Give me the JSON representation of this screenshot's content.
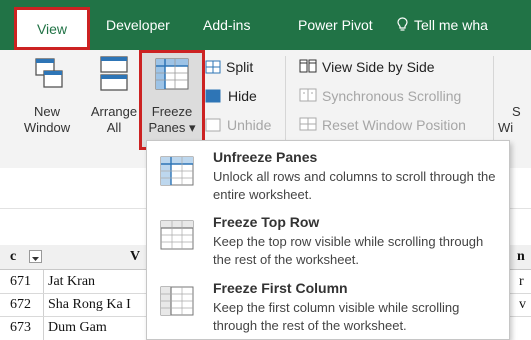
{
  "tabs": {
    "view": "View",
    "developer": "Developer",
    "addins": "Add-ins",
    "powerpivot": "Power Pivot",
    "tellme": "Tell me wha"
  },
  "ribbon": {
    "new_window": [
      "New",
      "Window"
    ],
    "arrange_all": [
      "Arrange",
      "All"
    ],
    "freeze_panes": [
      "Freeze",
      "Panes ▾"
    ],
    "split": "Split",
    "hide": "Hide",
    "unhide": "Unhide",
    "view_side_by_side": "View Side by Side",
    "synchronous_scrolling": "Synchronous Scrolling",
    "reset_window_position": "Reset Window Position",
    "switch_windows_cut": [
      "S",
      "Wi"
    ]
  },
  "menu": [
    {
      "title": "Unfreeze Panes",
      "desc": "Unlock all rows and columns to scroll through the entire worksheet."
    },
    {
      "title": "Freeze Top Row",
      "desc": "Keep the top row visible while scrolling through the rest of the worksheet."
    },
    {
      "title": "Freeze First Column",
      "desc": "Keep the first column visible while scrolling through the rest of the worksheet."
    }
  ],
  "sheet": {
    "header_col1": "c",
    "header_col2": "V",
    "header_right": "n",
    "rows": [
      {
        "num": "671",
        "name": "Jat Kran",
        "right": "r"
      },
      {
        "num": "672",
        "name": "Sha Rong Ka I",
        "right": "v"
      },
      {
        "num": "673",
        "name": "Dum Gam",
        "right": ""
      }
    ]
  },
  "colors": {
    "ribbon_green": "#217346",
    "highlight_red": "#cc2222"
  }
}
